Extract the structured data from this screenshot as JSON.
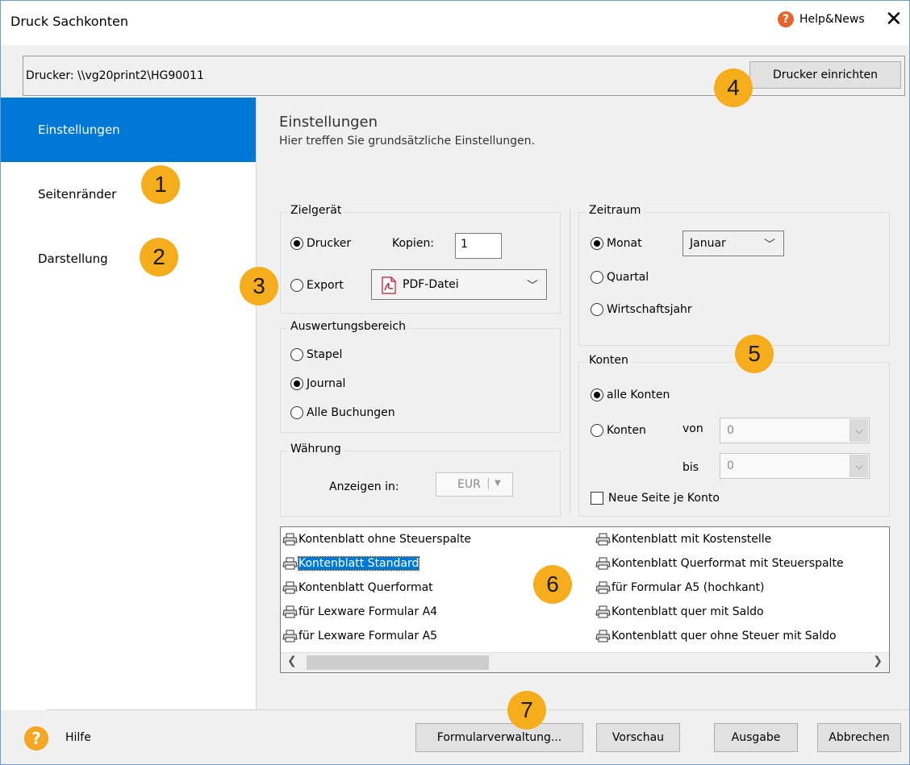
{
  "window": {
    "title": "Druck Sachkonten",
    "help_news": "Help&News",
    "close": "✕"
  },
  "printer_bar": {
    "label": "Drucker:  \\\\vg20print2\\HG90011",
    "setup_button": "Drucker einrichten"
  },
  "sidebar": {
    "items": [
      {
        "label": "Einstellungen",
        "active": true
      },
      {
        "label": "Seitenränder",
        "active": false
      },
      {
        "label": "Darstellung",
        "active": false
      }
    ]
  },
  "section": {
    "title": "Einstellungen",
    "subtitle": "Hier treffen Sie grundsätzliche Einstellungen."
  },
  "zielgeraet": {
    "label": "Zielgerät",
    "drucker": "Drucker",
    "kopien_label": "Kopien:",
    "kopien_value": "1",
    "export": "Export",
    "export_format": "PDF-Datei"
  },
  "auswertung": {
    "label": "Auswertungsbereich",
    "options": [
      "Stapel",
      "Journal",
      "Alle Buchungen"
    ],
    "selected": "Journal"
  },
  "waehrung": {
    "label": "Währung",
    "anzeigen_label": "Anzeigen in:",
    "value": "EUR"
  },
  "zeitraum": {
    "label": "Zeitraum",
    "monat": "Monat",
    "monat_value": "Januar",
    "quartal": "Quartal",
    "wirtschaftsjahr": "Wirtschaftsjahr",
    "selected": "Monat"
  },
  "konten": {
    "label": "Konten",
    "alle": "alle Konten",
    "konten": "Konten",
    "von_label": "von",
    "von_value": "0",
    "bis_label": "bis",
    "bis_value": "0",
    "neue_seite": "Neue Seite je Konto"
  },
  "forms": {
    "left": [
      "Kontenblatt ohne Steuerspalte",
      "Kontenblatt Standard",
      "Kontenblatt Querformat",
      "für Lexware Formular A4",
      "für Lexware Formular A5"
    ],
    "right": [
      "Kontenblatt mit Kostenstelle",
      "Kontenblatt Querformat mit Steuerspalte",
      "für Formular A5 (hochkant)",
      "Kontenblatt quer mit Saldo",
      "Kontenblatt quer ohne Steuer mit Saldo"
    ],
    "selected": "Kontenblatt Standard"
  },
  "footer": {
    "hilfe": "Hilfe",
    "formularverwaltung": "Formularverwaltung...",
    "vorschau": "Vorschau",
    "ausgabe": "Ausgabe",
    "abbrechen": "Abbrechen"
  },
  "callouts": [
    "1",
    "2",
    "3",
    "4",
    "5",
    "6",
    "7"
  ],
  "colors": {
    "accent": "#0078d7",
    "callout": "#f5ad1b",
    "help_icon": "#f5a623"
  }
}
